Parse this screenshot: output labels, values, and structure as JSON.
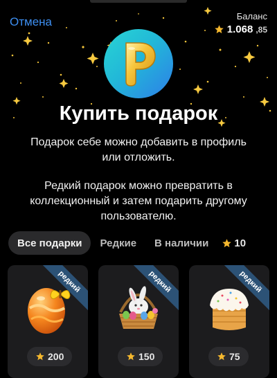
{
  "header": {
    "cancel_label": "Отмена",
    "balance_label": "Баланс",
    "balance_int": "1.068",
    "balance_dec": ",85"
  },
  "title": "Купить подарок",
  "description_1": "Подарок себе можно добавить в профиль или отложить.",
  "description_2": "Редкий подарок можно превратить в коллекционный и затем подарить другому пользователю.",
  "tabs": [
    {
      "label": "Все подарки",
      "active": true
    },
    {
      "label": "Редкие",
      "active": false
    },
    {
      "label": "В наличии",
      "active": false
    }
  ],
  "tab_stars_count": "10",
  "gifts": [
    {
      "badge": "редкий",
      "price": "200",
      "icon": "easter-egg-icon"
    },
    {
      "badge": "редкий",
      "price": "150",
      "icon": "bunny-basket-icon"
    },
    {
      "badge": "редкий",
      "price": "75",
      "icon": "easter-cake-icon"
    }
  ],
  "colors": {
    "accent": "#3d8ef0",
    "star": "#f5b82e",
    "badge": "#2c5276",
    "card": "#1c1c1e"
  }
}
